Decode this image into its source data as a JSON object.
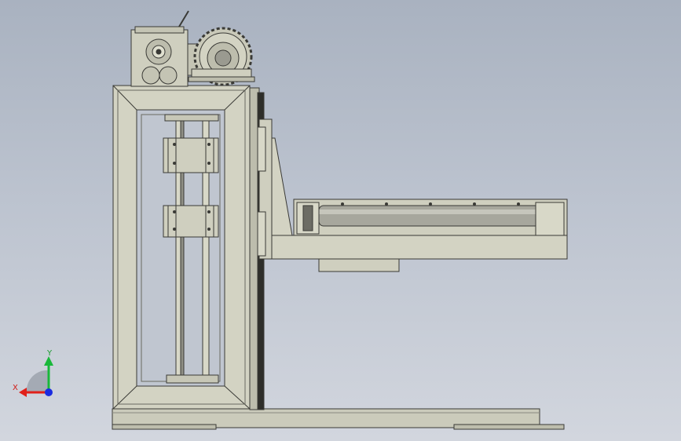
{
  "viewport": {
    "background_top": "#a9b2c0",
    "background_bottom": "#d2d6de",
    "part_fill": "#cfcfbf",
    "part_stroke": "#3a3a36"
  },
  "triad": {
    "x_label": "X",
    "y_label": "Y",
    "x_color": "#e0201a",
    "y_color": "#19b83a",
    "z_color": "#1a2be0"
  }
}
